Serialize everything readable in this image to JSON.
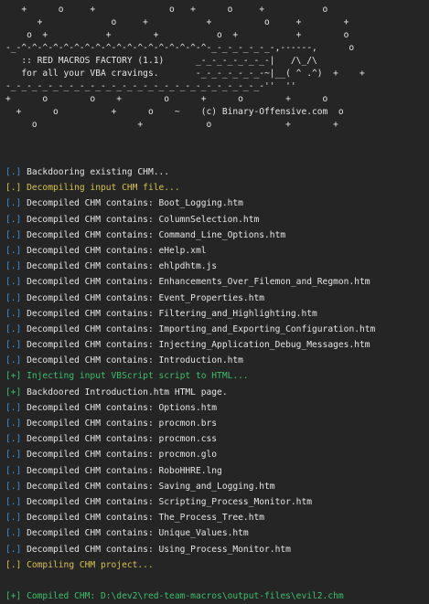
{
  "banner": {
    "lines": [
      "   +      o     +              o   +      o     +           o",
      "      +             o     +           +          o     +        +",
      "    o  +           +        +           o  +           +        o",
      "-_-^-^-^-^-^-^-^-^-^-^-^-^-^-^-^-^-^-^-_-_-_-_-_-_-,------,      o",
      "   :: RED MACROS FACTORY (1.1)      _-_-_-_-_-_-_-|   /\\_/\\",
      "   for all your VBA cravings.       -_-_-_-_-_-_-~|__( ^ .^)  +    +",
      "-_-_-_-_-_-_-_-_-_-_-_-_-_-_-_-_-_-_-_-_-_-_-_-_-''  ''",
      "+      o        o    +        o      +      o        +      o",
      "  +      o          +      o    ~    (c) Binary-Offensive.com  o",
      "     o                   +            o              +        +"
    ]
  },
  "log": [
    {
      "prefix": "[.]",
      "type": "info",
      "text": "Backdooring existing CHM..."
    },
    {
      "prefix": "[.]",
      "type": "warn",
      "text": "Decompiling input CHM file..."
    },
    {
      "prefix": "[.]",
      "type": "info",
      "text": "Decompiled CHM contains: Boot_Logging.htm"
    },
    {
      "prefix": "[.]",
      "type": "info",
      "text": "Decompiled CHM contains: ColumnSelection.htm"
    },
    {
      "prefix": "[.]",
      "type": "info",
      "text": "Decompiled CHM contains: Command_Line_Options.htm"
    },
    {
      "prefix": "[.]",
      "type": "info",
      "text": "Decompiled CHM contains: eHelp.xml"
    },
    {
      "prefix": "[.]",
      "type": "info",
      "text": "Decompiled CHM contains: ehlpdhtm.js"
    },
    {
      "prefix": "[.]",
      "type": "info",
      "text": "Decompiled CHM contains: Enhancements_Over_Filemon_and_Regmon.htm"
    },
    {
      "prefix": "[.]",
      "type": "info",
      "text": "Decompiled CHM contains: Event_Properties.htm"
    },
    {
      "prefix": "[.]",
      "type": "info",
      "text": "Decompiled CHM contains: Filtering_and_Highlighting.htm"
    },
    {
      "prefix": "[.]",
      "type": "info",
      "text": "Decompiled CHM contains: Importing_and_Exporting_Configuration.htm"
    },
    {
      "prefix": "[.]",
      "type": "info",
      "text": "Decompiled CHM contains: Injecting_Application_Debug_Messages.htm"
    },
    {
      "prefix": "[.]",
      "type": "info",
      "text": "Decompiled CHM contains: Introduction.htm"
    },
    {
      "prefix": "[+]",
      "type": "ok",
      "text": "Injecting input VBScript script to HTML..."
    },
    {
      "prefix": "[+]",
      "type": "ok2",
      "text": "Backdoored Introduction.htm HTML page."
    },
    {
      "prefix": "[.]",
      "type": "info",
      "text": "Decompiled CHM contains: Options.htm"
    },
    {
      "prefix": "[.]",
      "type": "info",
      "text": "Decompiled CHM contains: procmon.brs"
    },
    {
      "prefix": "[.]",
      "type": "info",
      "text": "Decompiled CHM contains: procmon.css"
    },
    {
      "prefix": "[.]",
      "type": "info",
      "text": "Decompiled CHM contains: procmon.glo"
    },
    {
      "prefix": "[.]",
      "type": "info",
      "text": "Decompiled CHM contains: RoboHHRE.lng"
    },
    {
      "prefix": "[.]",
      "type": "info",
      "text": "Decompiled CHM contains: Saving_and_Logging.htm"
    },
    {
      "prefix": "[.]",
      "type": "info",
      "text": "Decompiled CHM contains: Scripting_Process_Monitor.htm"
    },
    {
      "prefix": "[.]",
      "type": "info",
      "text": "Decompiled CHM contains: The_Process_Tree.htm"
    },
    {
      "prefix": "[.]",
      "type": "info",
      "text": "Decompiled CHM contains: Unique_Values.htm"
    },
    {
      "prefix": "[.]",
      "type": "info",
      "text": "Decompiled CHM contains: Using_Process_Monitor.htm"
    },
    {
      "prefix": "[.]",
      "type": "warn",
      "text": "Compiling CHM project..."
    },
    {
      "prefix": "",
      "type": "spacer",
      "text": ""
    },
    {
      "prefix": "[+]",
      "type": "ok",
      "text": "Compiled CHM: D:\\dev2\\red-team-macros\\output-files\\evil2.chm"
    }
  ],
  "colors": {
    "background": "#252525",
    "text": "#e6e6e6",
    "info_prefix": "#3b8ed6",
    "warn": "#d7c24a",
    "ok": "#39c06a"
  }
}
